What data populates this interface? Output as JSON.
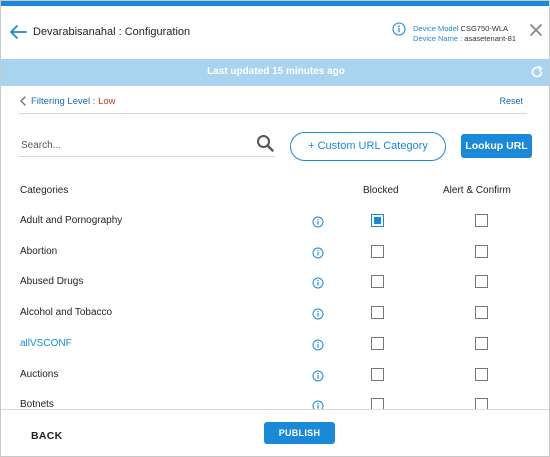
{
  "header": {
    "title": "Devarabisanahal : Configuration",
    "device_model_label": "Device Model",
    "device_model_value": "CSG750-WLA",
    "device_name_label": "Device Name :",
    "device_name_value": "asasetenant-81"
  },
  "status": {
    "text": "Last updated 15 minutes ago"
  },
  "filter": {
    "label": "Filtering Level :",
    "value": "Low",
    "reset_label": "Reset"
  },
  "search": {
    "placeholder": "Search..."
  },
  "buttons": {
    "custom_url": "+ Custom URL Category",
    "lookup_url": "Lookup URL"
  },
  "table": {
    "headers": {
      "categories": "Categories",
      "blocked": "Blocked",
      "alert": "Alert & Confirm"
    },
    "rows": [
      {
        "name": "Adult and Pornography",
        "blocked": true,
        "alert": false,
        "link": false
      },
      {
        "name": "Abortion",
        "blocked": false,
        "alert": false,
        "link": false
      },
      {
        "name": "Abused Drugs",
        "blocked": false,
        "alert": false,
        "link": false
      },
      {
        "name": "Alcohol and Tobacco",
        "blocked": false,
        "alert": false,
        "link": false
      },
      {
        "name": "allVSCONF",
        "blocked": false,
        "alert": false,
        "link": true
      },
      {
        "name": "Auctions",
        "blocked": false,
        "alert": false,
        "link": false
      },
      {
        "name": "Botnets",
        "blocked": false,
        "alert": false,
        "link": false
      }
    ]
  },
  "footer": {
    "back_label": "BACK",
    "publish_label": "PUBLISH"
  },
  "colors": {
    "accent": "#1a8ad8",
    "status_bar": "#a9d4ef",
    "filter_value": "#c0392b"
  },
  "icons": [
    "back-arrow-icon",
    "info-icon",
    "close-icon",
    "refresh-icon",
    "chevron-left-icon",
    "search-icon"
  ]
}
